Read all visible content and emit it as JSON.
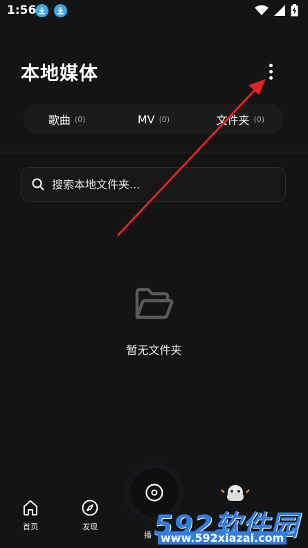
{
  "status_bar": {
    "time": "1:56",
    "icons": [
      "download-icon",
      "download-icon",
      "wifi-icon",
      "signal-icon",
      "battery-charging-icon"
    ]
  },
  "header": {
    "title": "本地媒体",
    "more_icon": "more-vertical-icon"
  },
  "tabs": [
    {
      "label": "歌曲",
      "count": "(0)"
    },
    {
      "label": "MV",
      "count": "(0)"
    },
    {
      "label": "文件夹",
      "count": "(0)"
    }
  ],
  "search": {
    "placeholder": "搜索本地文件夹...",
    "value": "",
    "icon": "search-icon"
  },
  "empty_state": {
    "icon": "open-folder-icon",
    "text": "暂无文件夹"
  },
  "bottom_nav": {
    "items": [
      {
        "label": "首页",
        "icon": "home-icon"
      },
      {
        "label": "发现",
        "icon": "compass-icon"
      },
      {
        "label": "播",
        "icon": "disc-icon"
      }
    ]
  },
  "watermark": {
    "brand": "592软件园",
    "url": "www.592xiazai.com"
  },
  "colors": {
    "background": "#141414",
    "annotation_arrow": "#e02424",
    "download_badge": "#3aa8e8",
    "watermark_blue": "#2f7de1"
  }
}
